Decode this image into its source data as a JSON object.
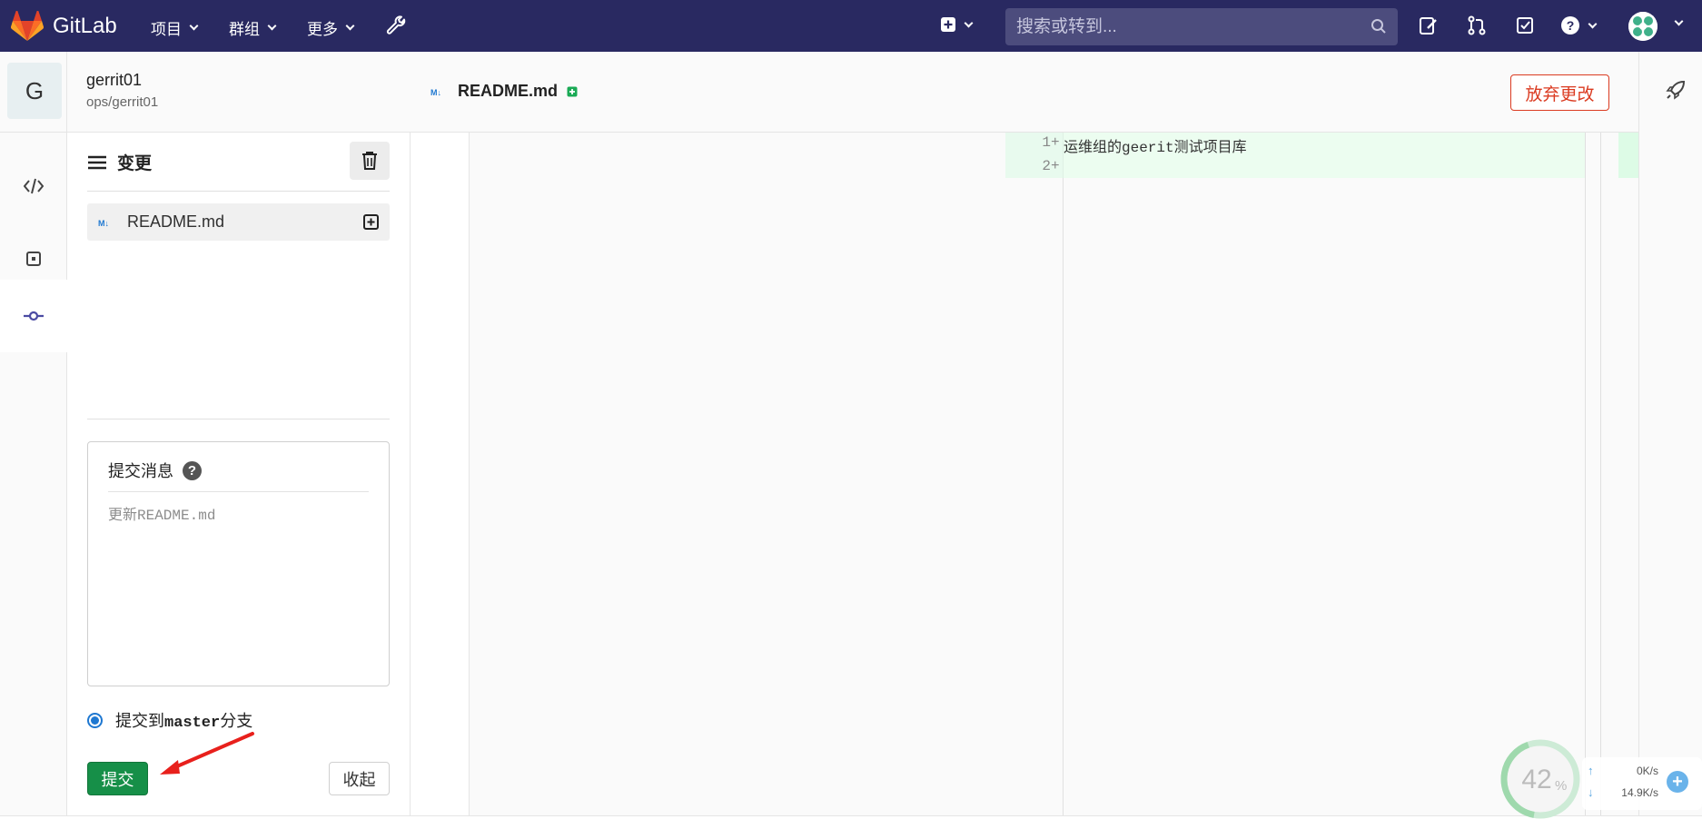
{
  "header": {
    "brand": "GitLab",
    "menus": [
      {
        "label": "项目"
      },
      {
        "label": "群组"
      },
      {
        "label": "更多"
      }
    ],
    "search_placeholder": "搜索或转到..."
  },
  "project": {
    "initial": "G",
    "name": "gerrit01",
    "path": "ops/gerrit01"
  },
  "changes": {
    "title": "变更",
    "files": [
      {
        "name": "README.md"
      }
    ]
  },
  "commit": {
    "label": "提交消息",
    "help": "?",
    "placeholder": "更新README.md",
    "radio_prefix": "提交到",
    "branch": "master",
    "radio_suffix": "分支",
    "submit_label": "提交",
    "collapse_label": "收起"
  },
  "editor": {
    "tab_file": "README.md",
    "discard_label": "放弃更改",
    "lines": [
      {
        "num": "1",
        "sign": "+",
        "text": "运维组的geerit测试项目库"
      },
      {
        "num": "2",
        "sign": "+",
        "text": ""
      }
    ]
  },
  "monitor": {
    "percent": "42",
    "percent_unit": "%",
    "upload": "0K/s",
    "download": "14.9K/s"
  },
  "colors": {
    "topbar": "#292961",
    "commit_button": "#168f48",
    "discard": "#db3b21",
    "added_line": "#ecfdf0"
  }
}
